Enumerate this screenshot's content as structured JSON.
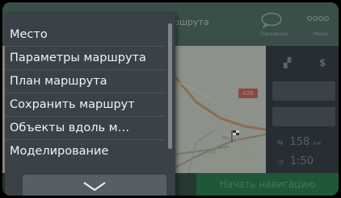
{
  "menu": {
    "items": [
      {
        "label": "Место"
      },
      {
        "label": "Параметры маршрута"
      },
      {
        "label": "План маршрута"
      },
      {
        "label": "Сохранить маршрут"
      },
      {
        "label": "Объекты вдоль м…"
      },
      {
        "label": "Моделирование"
      }
    ],
    "more_icon": "chevron-down-icon"
  },
  "background": {
    "title": "ршрута",
    "top_buttons": [
      {
        "label": "Показания",
        "icon": "speech-bubble-icon"
      },
      {
        "label": "Меню",
        "icon": "menu-icon"
      }
    ],
    "road_sign": "A26",
    "map_label": "Tro",
    "map_road_label": "20",
    "side_icons": [
      "road-icon",
      "cost-icon"
    ],
    "stats": [
      {
        "value": "158",
        "unit": "км",
        "icon": "distance-icon"
      },
      {
        "value": "1:50",
        "unit": "",
        "icon": "time-icon"
      }
    ],
    "start_button": "Начать навигацию"
  },
  "colors": {
    "menu_bg": "#3a4148",
    "menu_text": "#f2f4f5",
    "start_button_bg": "#1f5838"
  }
}
